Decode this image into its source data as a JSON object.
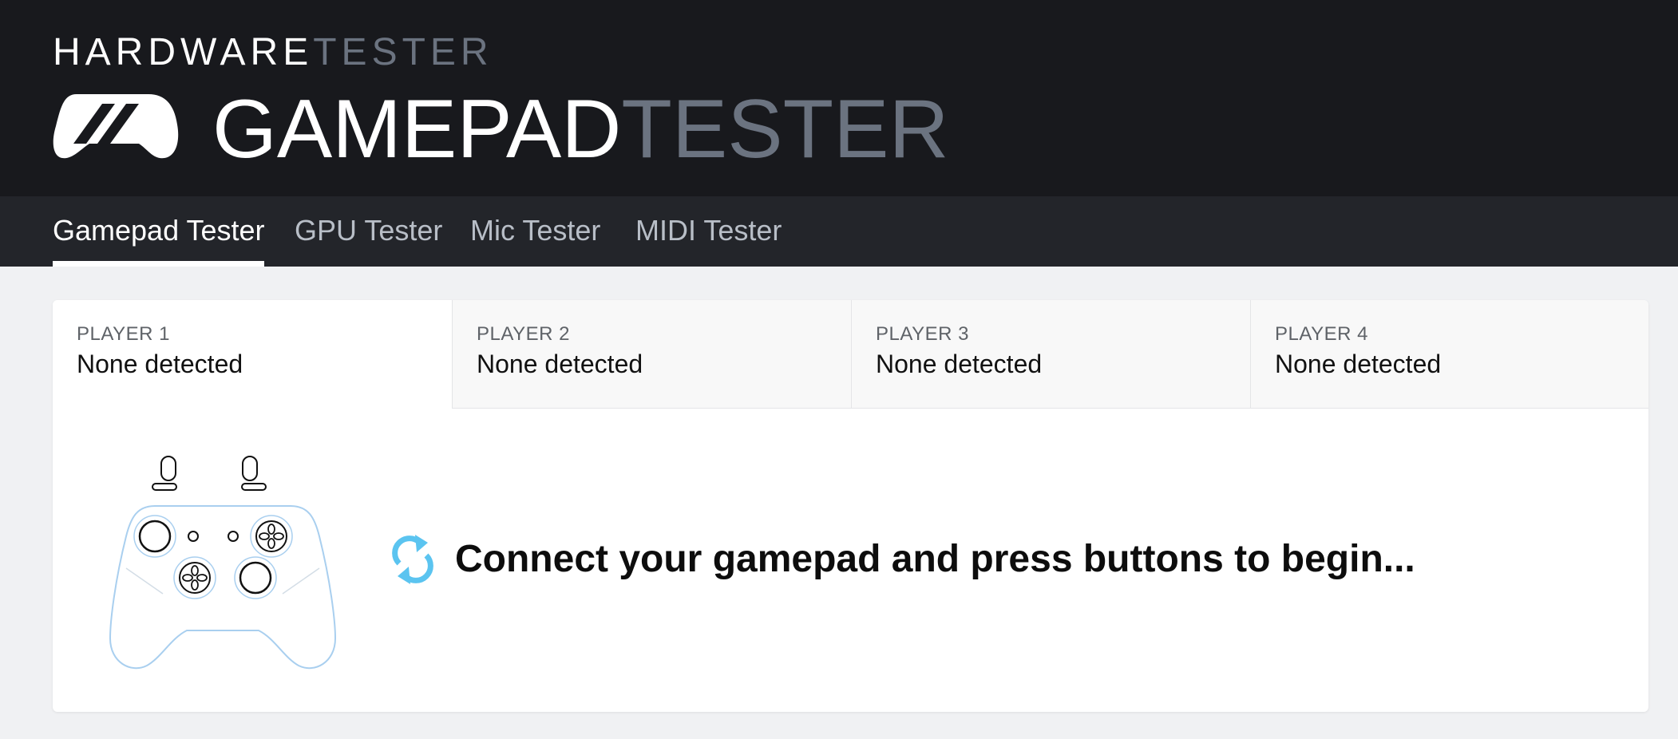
{
  "header": {
    "brand_small_white": "HARDWARE",
    "brand_small_gray": "TESTER",
    "brand_big_white": "GAMEPAD",
    "brand_big_gray": "TESTER",
    "logo_icon": "gamepad-logo-icon"
  },
  "nav": {
    "tabs": [
      {
        "label": "Gamepad Tester",
        "active": true
      },
      {
        "label": "GPU Tester",
        "active": false
      },
      {
        "label": "Mic Tester",
        "active": false
      },
      {
        "label": "MIDI Tester",
        "active": false
      }
    ]
  },
  "players": [
    {
      "label": "PLAYER 1",
      "status": "None detected",
      "active": true
    },
    {
      "label": "PLAYER 2",
      "status": "None detected",
      "active": false
    },
    {
      "label": "PLAYER 3",
      "status": "None detected",
      "active": false
    },
    {
      "label": "PLAYER 4",
      "status": "None detected",
      "active": false
    }
  ],
  "main": {
    "message": "Connect your gamepad and press buttons to begin...",
    "illustration_icon": "gamepad-outline-icon",
    "status_icon": "refresh-icon"
  },
  "colors": {
    "header_bg": "#18191d",
    "nav_bg": "#23252a",
    "accent_blue": "#5bc4f0",
    "brand_gray": "#6b7380"
  }
}
